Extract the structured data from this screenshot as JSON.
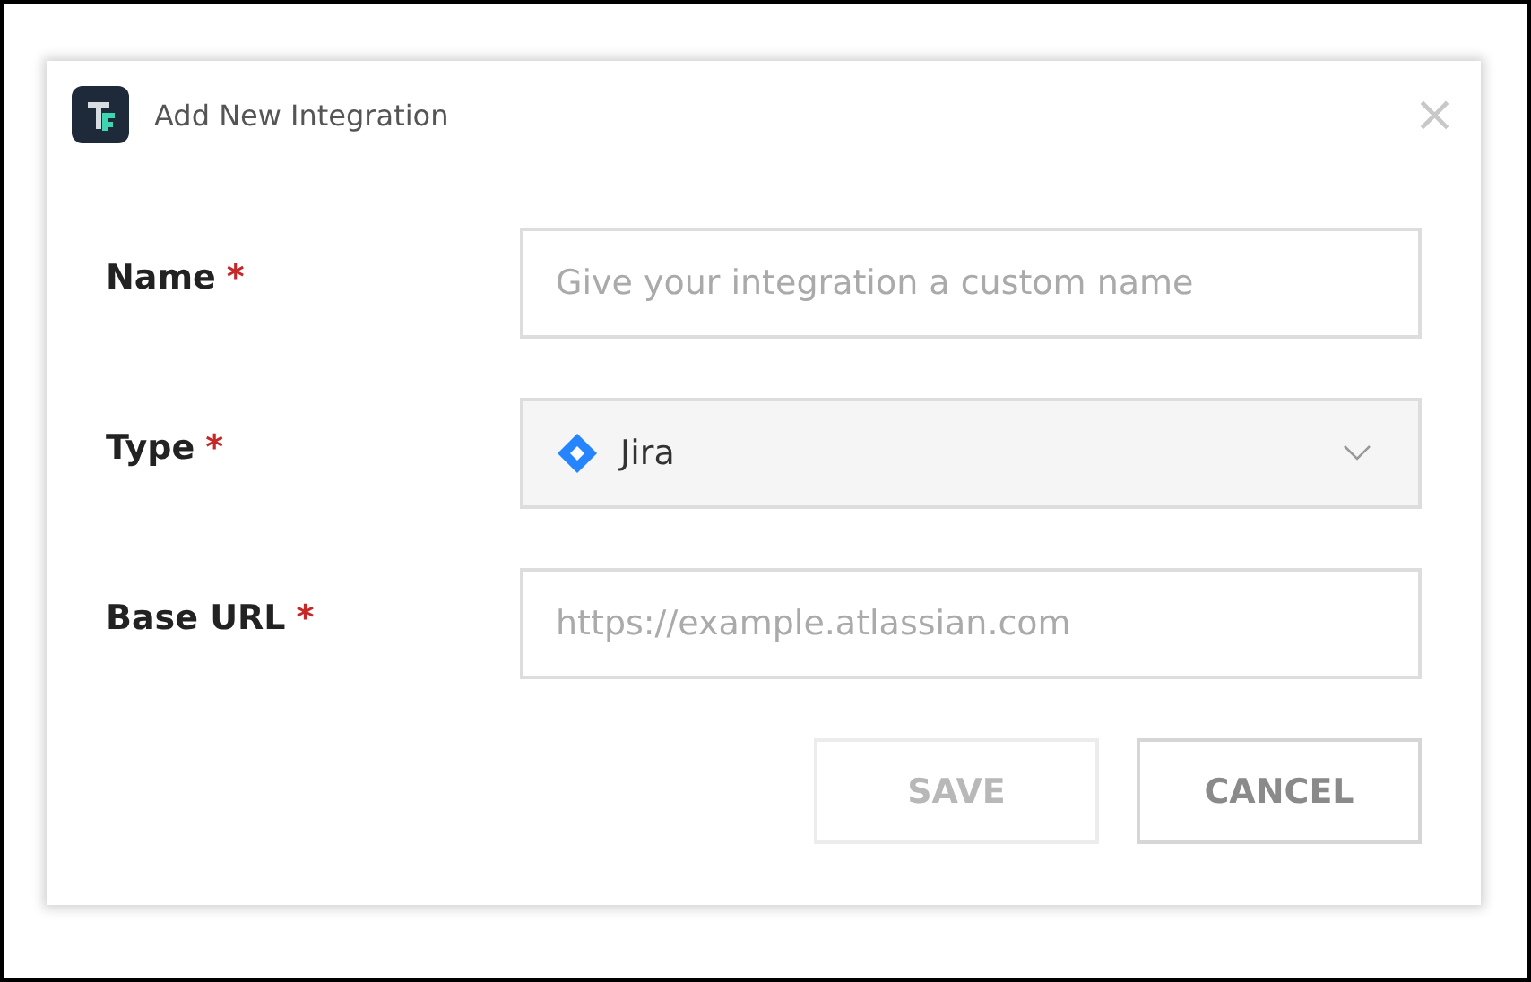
{
  "dialog": {
    "title": "Add New Integration",
    "close": "×"
  },
  "fields": [
    {
      "kind": "text",
      "label": "Name",
      "required_mark": "*",
      "placeholder": "Give your integration a custom name"
    },
    {
      "kind": "select",
      "label": "Type",
      "required_mark": "*",
      "value": "Jira"
    },
    {
      "kind": "text",
      "label": "Base URL",
      "required_mark": "*",
      "placeholder": "https://example.atlassian.com"
    }
  ],
  "buttons": [
    {
      "label": "SAVE",
      "disabled": true
    },
    {
      "label": "CANCEL",
      "disabled": false
    }
  ]
}
